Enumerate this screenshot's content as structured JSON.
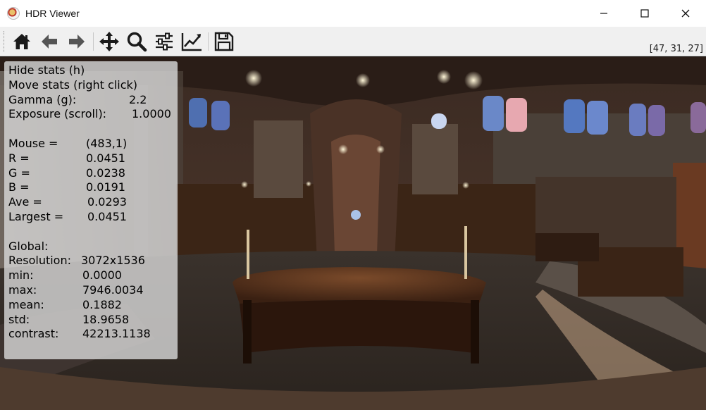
{
  "window": {
    "title": "HDR Viewer"
  },
  "toolbar": {
    "buttons": [
      {
        "icon": "home-icon",
        "tooltip": ""
      },
      {
        "icon": "back-arrow-icon",
        "tooltip": ""
      },
      {
        "icon": "forward-arrow-icon",
        "tooltip": ""
      },
      {
        "icon": "pan-icon",
        "tooltip": ""
      },
      {
        "icon": "zoom-icon",
        "tooltip": ""
      },
      {
        "icon": "sliders-icon",
        "tooltip": ""
      },
      {
        "icon": "line-chart-icon",
        "tooltip": ""
      },
      {
        "icon": "save-icon",
        "tooltip": ""
      }
    ],
    "pixel_value_readout": "[47, 31, 27]"
  },
  "stats": {
    "hide": "Hide stats (h)",
    "move": "Move stats (right click)",
    "gamma_label": "Gamma (g):",
    "gamma_value": "2.2",
    "exposure_label": "Exposure (scroll):",
    "exposure_value": "1.0000",
    "mouse_label": "Mouse =",
    "mouse_value": "(483,1)",
    "r_label": "R =",
    "r_value": "0.0451",
    "g_label": "G =",
    "g_value": "0.0238",
    "b_label": "B =",
    "b_value": "0.0191",
    "ave_label": "Ave =",
    "ave_value": "0.0293",
    "largest_label": "Largest =",
    "largest_value": "0.0451",
    "global_label": "Global:",
    "resolution_label": "Resolution:",
    "resolution_value": "3072x1536",
    "min_label": "min:",
    "min_value": "0.0000",
    "max_label": "max:",
    "max_value": "7946.0034",
    "mean_label": "mean:",
    "mean_value": "0.1882",
    "std_label": "std:",
    "std_value": "18.9658",
    "contrast_label": "contrast:",
    "contrast_value": "42213.1138"
  },
  "colors": {
    "toolbar_bg": "#f0f0f0",
    "icon_dark": "#1a1a1a",
    "icon_gray": "#555555",
    "stats_bg": "#d6d6d6"
  }
}
